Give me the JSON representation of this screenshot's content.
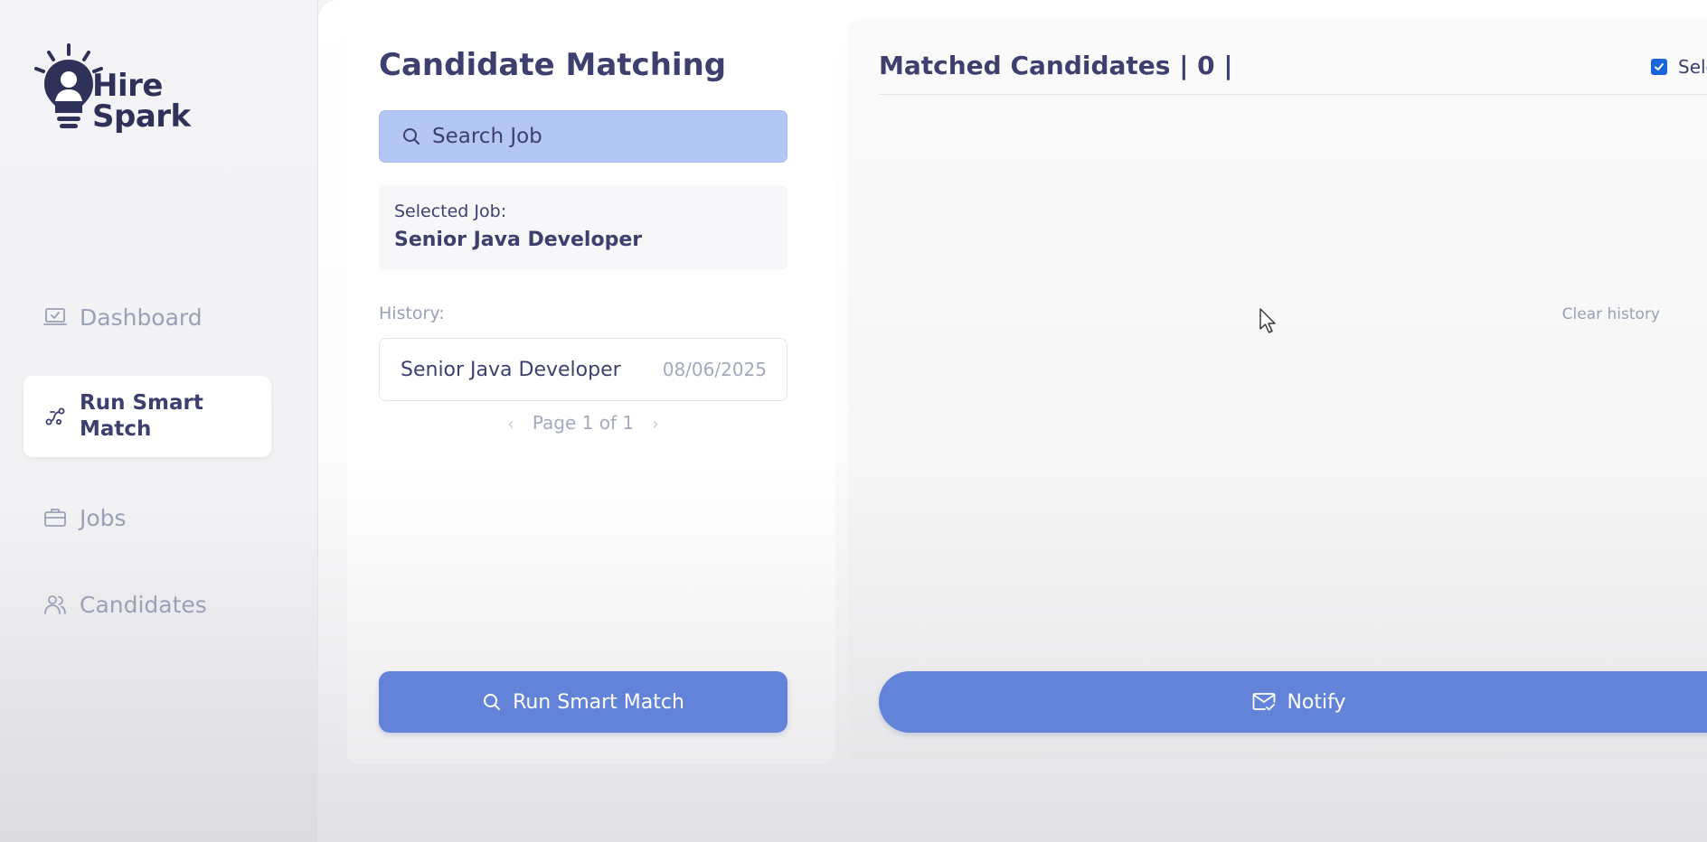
{
  "app": {
    "logo_line1": "Hire",
    "logo_line2": "Spark"
  },
  "sidebar": {
    "items": [
      {
        "label": "Dashboard",
        "icon": "laptop-check-icon"
      },
      {
        "label": "Run Smart Match",
        "icon": "route-icon",
        "active": true
      },
      {
        "label": "Jobs",
        "icon": "briefcase-icon"
      },
      {
        "label": "Candidates",
        "icon": "users-icon"
      }
    ]
  },
  "left": {
    "title": "Candidate Matching",
    "search_placeholder": "Search Job",
    "selected_label": "Selected Job:",
    "selected_value": "Senior Java Developer",
    "history_label": "History:",
    "clear_history": "Clear history",
    "history": [
      {
        "job": "Senior Java Developer",
        "date": "08/06/2025"
      }
    ],
    "pagination": "Page 1 of 1",
    "run_button": "Run Smart Match"
  },
  "right": {
    "title": "Matched Candidates | 0 |",
    "select_all": "Sele",
    "select_all_checked": true,
    "notify_button": "Notify"
  },
  "colors": {
    "accent": "#6283d7",
    "search_bg": "#b4c6f3",
    "text": "#3d3f6e",
    "muted": "#9aa0b6"
  }
}
